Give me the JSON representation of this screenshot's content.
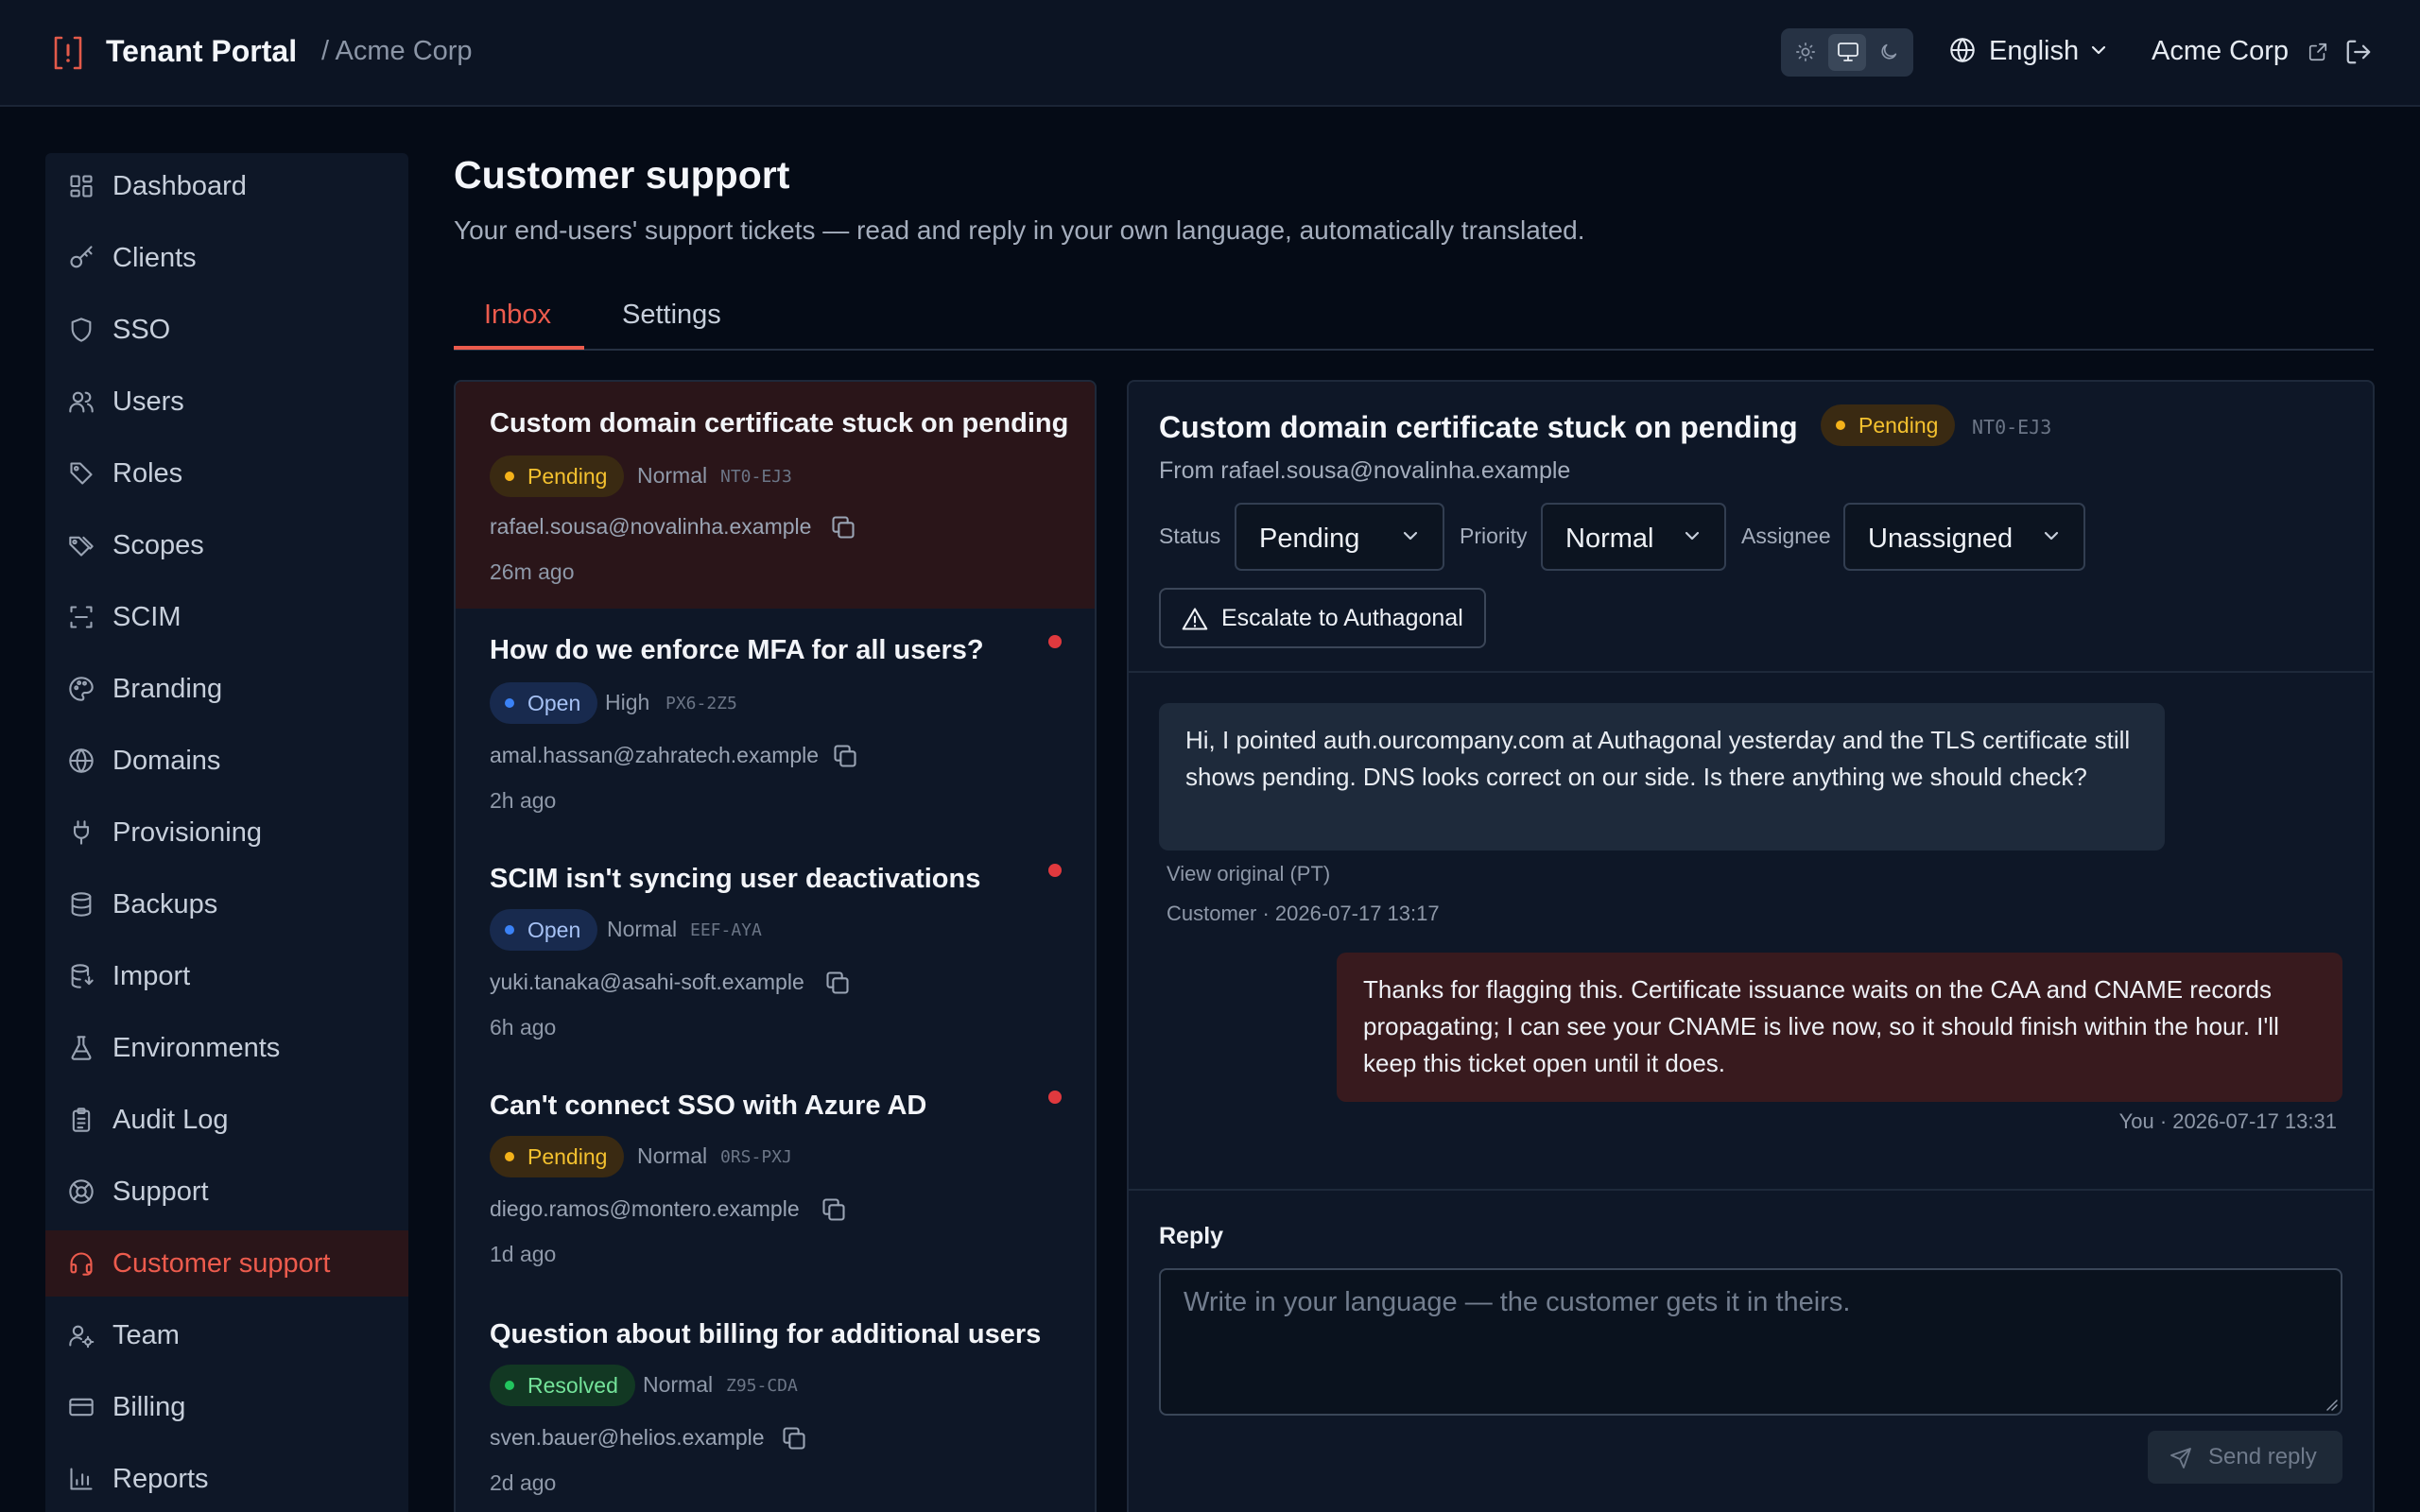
{
  "header": {
    "app_title": "Tenant Portal",
    "tenant_breadcrumb": "/ Acme Corp",
    "theme_options": [
      "light",
      "system",
      "dark"
    ],
    "theme_selected": "system",
    "language": "English",
    "tenant_link": "Acme Corp"
  },
  "sidebar": {
    "items": [
      {
        "label": "Dashboard",
        "icon": "dashboard-icon"
      },
      {
        "label": "Clients",
        "icon": "key-icon"
      },
      {
        "label": "SSO",
        "icon": "shield-icon"
      },
      {
        "label": "Users",
        "icon": "users-icon"
      },
      {
        "label": "Roles",
        "icon": "tag-icon"
      },
      {
        "label": "Scopes",
        "icon": "tags-icon"
      },
      {
        "label": "SCIM",
        "icon": "scan-icon"
      },
      {
        "label": "Branding",
        "icon": "palette-icon"
      },
      {
        "label": "Domains",
        "icon": "globe-icon"
      },
      {
        "label": "Provisioning",
        "icon": "plug-icon"
      },
      {
        "label": "Backups",
        "icon": "database-icon"
      },
      {
        "label": "Import",
        "icon": "database-import-icon"
      },
      {
        "label": "Environments",
        "icon": "flask-icon"
      },
      {
        "label": "Audit Log",
        "icon": "clipboard-icon"
      },
      {
        "label": "Support",
        "icon": "lifebuoy-icon"
      },
      {
        "label": "Customer support",
        "icon": "headset-icon"
      },
      {
        "label": "Team",
        "icon": "user-cog-icon"
      },
      {
        "label": "Billing",
        "icon": "credit-card-icon"
      },
      {
        "label": "Reports",
        "icon": "bar-chart-icon"
      }
    ],
    "active": "Customer support"
  },
  "page": {
    "title": "Customer support",
    "subtitle": "Your end-users' support tickets — read and reply in your own language, automatically translated.",
    "tabs": [
      {
        "label": "Inbox"
      },
      {
        "label": "Settings"
      }
    ],
    "active_tab": "Inbox"
  },
  "tickets": [
    {
      "subject": "Custom domain certificate stuck on pending",
      "status": "Pending",
      "priority": "Normal",
      "code": "NT0-EJ3",
      "email": "rafael.sousa@novalinha.example",
      "time": "26m ago",
      "unread": false,
      "selected": true
    },
    {
      "subject": "How do we enforce MFA for all users?",
      "status": "Open",
      "priority": "High",
      "code": "PX6-2Z5",
      "email": "amal.hassan@zahratech.example",
      "time": "2h ago",
      "unread": true,
      "selected": false
    },
    {
      "subject": "SCIM isn't syncing user deactivations",
      "status": "Open",
      "priority": "Normal",
      "code": "EEF-AYA",
      "email": "yuki.tanaka@asahi-soft.example",
      "time": "6h ago",
      "unread": true,
      "selected": false
    },
    {
      "subject": "Can't connect SSO with Azure AD",
      "status": "Pending",
      "priority": "Normal",
      "code": "0RS-PXJ",
      "email": "diego.ramos@montero.example",
      "time": "1d ago",
      "unread": true,
      "selected": false
    },
    {
      "subject": "Question about billing for additional users",
      "status": "Resolved",
      "priority": "Normal",
      "code": "Z95-CDA",
      "email": "sven.bauer@helios.example",
      "time": "2d ago",
      "unread": false,
      "selected": false
    }
  ],
  "detail": {
    "title": "Custom domain certificate stuck on pending",
    "status_badge": "Pending",
    "code": "NT0-EJ3",
    "from": "From rafael.sousa@novalinha.example",
    "status_label": "Status",
    "status_value": "Pending",
    "priority_label": "Priority",
    "priority_value": "Normal",
    "assignee_label": "Assignee",
    "assignee_value": "Unassigned",
    "escalate_label": "Escalate to Authagonal",
    "messages": [
      {
        "direction": "in",
        "text": "Hi, I pointed auth.ourcompany.com at Authagonal yesterday and the TLS certificate still shows pending. DNS looks correct on our side. Is there anything we should check?",
        "original_link": "View original (PT)",
        "meta": "Customer · 2026-07-17 13:17"
      },
      {
        "direction": "out",
        "text": "Thanks for flagging this. Certificate issuance waits on the CAA and CNAME records propagating; I can see your CNAME is live now, so it should finish within the hour. I'll keep this ticket open until it does.",
        "meta": "You · 2026-07-17 13:31"
      }
    ],
    "reply_label": "Reply",
    "reply_placeholder": "Write in your language — the customer gets it in theirs.",
    "reply_value": "",
    "send_label": "Send reply"
  },
  "colors": {
    "accent": "#ec5b4d",
    "pending": "#f4b21a",
    "open": "#3b82f6",
    "resolved": "#22c55e",
    "unread_dot": "#e0393e"
  }
}
